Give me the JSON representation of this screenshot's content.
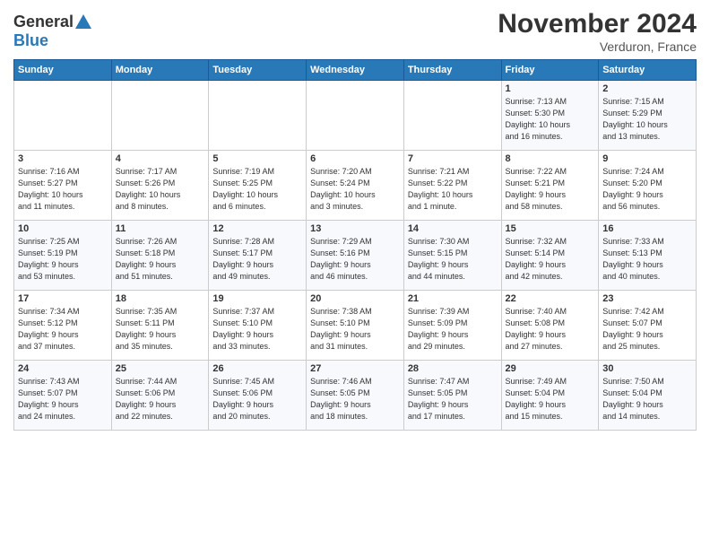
{
  "header": {
    "logo_line1": "General",
    "logo_line2": "Blue",
    "month_title": "November 2024",
    "location": "Verduron, France"
  },
  "days_of_week": [
    "Sunday",
    "Monday",
    "Tuesday",
    "Wednesday",
    "Thursday",
    "Friday",
    "Saturday"
  ],
  "weeks": [
    [
      {
        "day": "",
        "info": ""
      },
      {
        "day": "",
        "info": ""
      },
      {
        "day": "",
        "info": ""
      },
      {
        "day": "",
        "info": ""
      },
      {
        "day": "",
        "info": ""
      },
      {
        "day": "1",
        "info": "Sunrise: 7:13 AM\nSunset: 5:30 PM\nDaylight: 10 hours\nand 16 minutes."
      },
      {
        "day": "2",
        "info": "Sunrise: 7:15 AM\nSunset: 5:29 PM\nDaylight: 10 hours\nand 13 minutes."
      }
    ],
    [
      {
        "day": "3",
        "info": "Sunrise: 7:16 AM\nSunset: 5:27 PM\nDaylight: 10 hours\nand 11 minutes."
      },
      {
        "day": "4",
        "info": "Sunrise: 7:17 AM\nSunset: 5:26 PM\nDaylight: 10 hours\nand 8 minutes."
      },
      {
        "day": "5",
        "info": "Sunrise: 7:19 AM\nSunset: 5:25 PM\nDaylight: 10 hours\nand 6 minutes."
      },
      {
        "day": "6",
        "info": "Sunrise: 7:20 AM\nSunset: 5:24 PM\nDaylight: 10 hours\nand 3 minutes."
      },
      {
        "day": "7",
        "info": "Sunrise: 7:21 AM\nSunset: 5:22 PM\nDaylight: 10 hours\nand 1 minute."
      },
      {
        "day": "8",
        "info": "Sunrise: 7:22 AM\nSunset: 5:21 PM\nDaylight: 9 hours\nand 58 minutes."
      },
      {
        "day": "9",
        "info": "Sunrise: 7:24 AM\nSunset: 5:20 PM\nDaylight: 9 hours\nand 56 minutes."
      }
    ],
    [
      {
        "day": "10",
        "info": "Sunrise: 7:25 AM\nSunset: 5:19 PM\nDaylight: 9 hours\nand 53 minutes."
      },
      {
        "day": "11",
        "info": "Sunrise: 7:26 AM\nSunset: 5:18 PM\nDaylight: 9 hours\nand 51 minutes."
      },
      {
        "day": "12",
        "info": "Sunrise: 7:28 AM\nSunset: 5:17 PM\nDaylight: 9 hours\nand 49 minutes."
      },
      {
        "day": "13",
        "info": "Sunrise: 7:29 AM\nSunset: 5:16 PM\nDaylight: 9 hours\nand 46 minutes."
      },
      {
        "day": "14",
        "info": "Sunrise: 7:30 AM\nSunset: 5:15 PM\nDaylight: 9 hours\nand 44 minutes."
      },
      {
        "day": "15",
        "info": "Sunrise: 7:32 AM\nSunset: 5:14 PM\nDaylight: 9 hours\nand 42 minutes."
      },
      {
        "day": "16",
        "info": "Sunrise: 7:33 AM\nSunset: 5:13 PM\nDaylight: 9 hours\nand 40 minutes."
      }
    ],
    [
      {
        "day": "17",
        "info": "Sunrise: 7:34 AM\nSunset: 5:12 PM\nDaylight: 9 hours\nand 37 minutes."
      },
      {
        "day": "18",
        "info": "Sunrise: 7:35 AM\nSunset: 5:11 PM\nDaylight: 9 hours\nand 35 minutes."
      },
      {
        "day": "19",
        "info": "Sunrise: 7:37 AM\nSunset: 5:10 PM\nDaylight: 9 hours\nand 33 minutes."
      },
      {
        "day": "20",
        "info": "Sunrise: 7:38 AM\nSunset: 5:10 PM\nDaylight: 9 hours\nand 31 minutes."
      },
      {
        "day": "21",
        "info": "Sunrise: 7:39 AM\nSunset: 5:09 PM\nDaylight: 9 hours\nand 29 minutes."
      },
      {
        "day": "22",
        "info": "Sunrise: 7:40 AM\nSunset: 5:08 PM\nDaylight: 9 hours\nand 27 minutes."
      },
      {
        "day": "23",
        "info": "Sunrise: 7:42 AM\nSunset: 5:07 PM\nDaylight: 9 hours\nand 25 minutes."
      }
    ],
    [
      {
        "day": "24",
        "info": "Sunrise: 7:43 AM\nSunset: 5:07 PM\nDaylight: 9 hours\nand 24 minutes."
      },
      {
        "day": "25",
        "info": "Sunrise: 7:44 AM\nSunset: 5:06 PM\nDaylight: 9 hours\nand 22 minutes."
      },
      {
        "day": "26",
        "info": "Sunrise: 7:45 AM\nSunset: 5:06 PM\nDaylight: 9 hours\nand 20 minutes."
      },
      {
        "day": "27",
        "info": "Sunrise: 7:46 AM\nSunset: 5:05 PM\nDaylight: 9 hours\nand 18 minutes."
      },
      {
        "day": "28",
        "info": "Sunrise: 7:47 AM\nSunset: 5:05 PM\nDaylight: 9 hours\nand 17 minutes."
      },
      {
        "day": "29",
        "info": "Sunrise: 7:49 AM\nSunset: 5:04 PM\nDaylight: 9 hours\nand 15 minutes."
      },
      {
        "day": "30",
        "info": "Sunrise: 7:50 AM\nSunset: 5:04 PM\nDaylight: 9 hours\nand 14 minutes."
      }
    ]
  ]
}
